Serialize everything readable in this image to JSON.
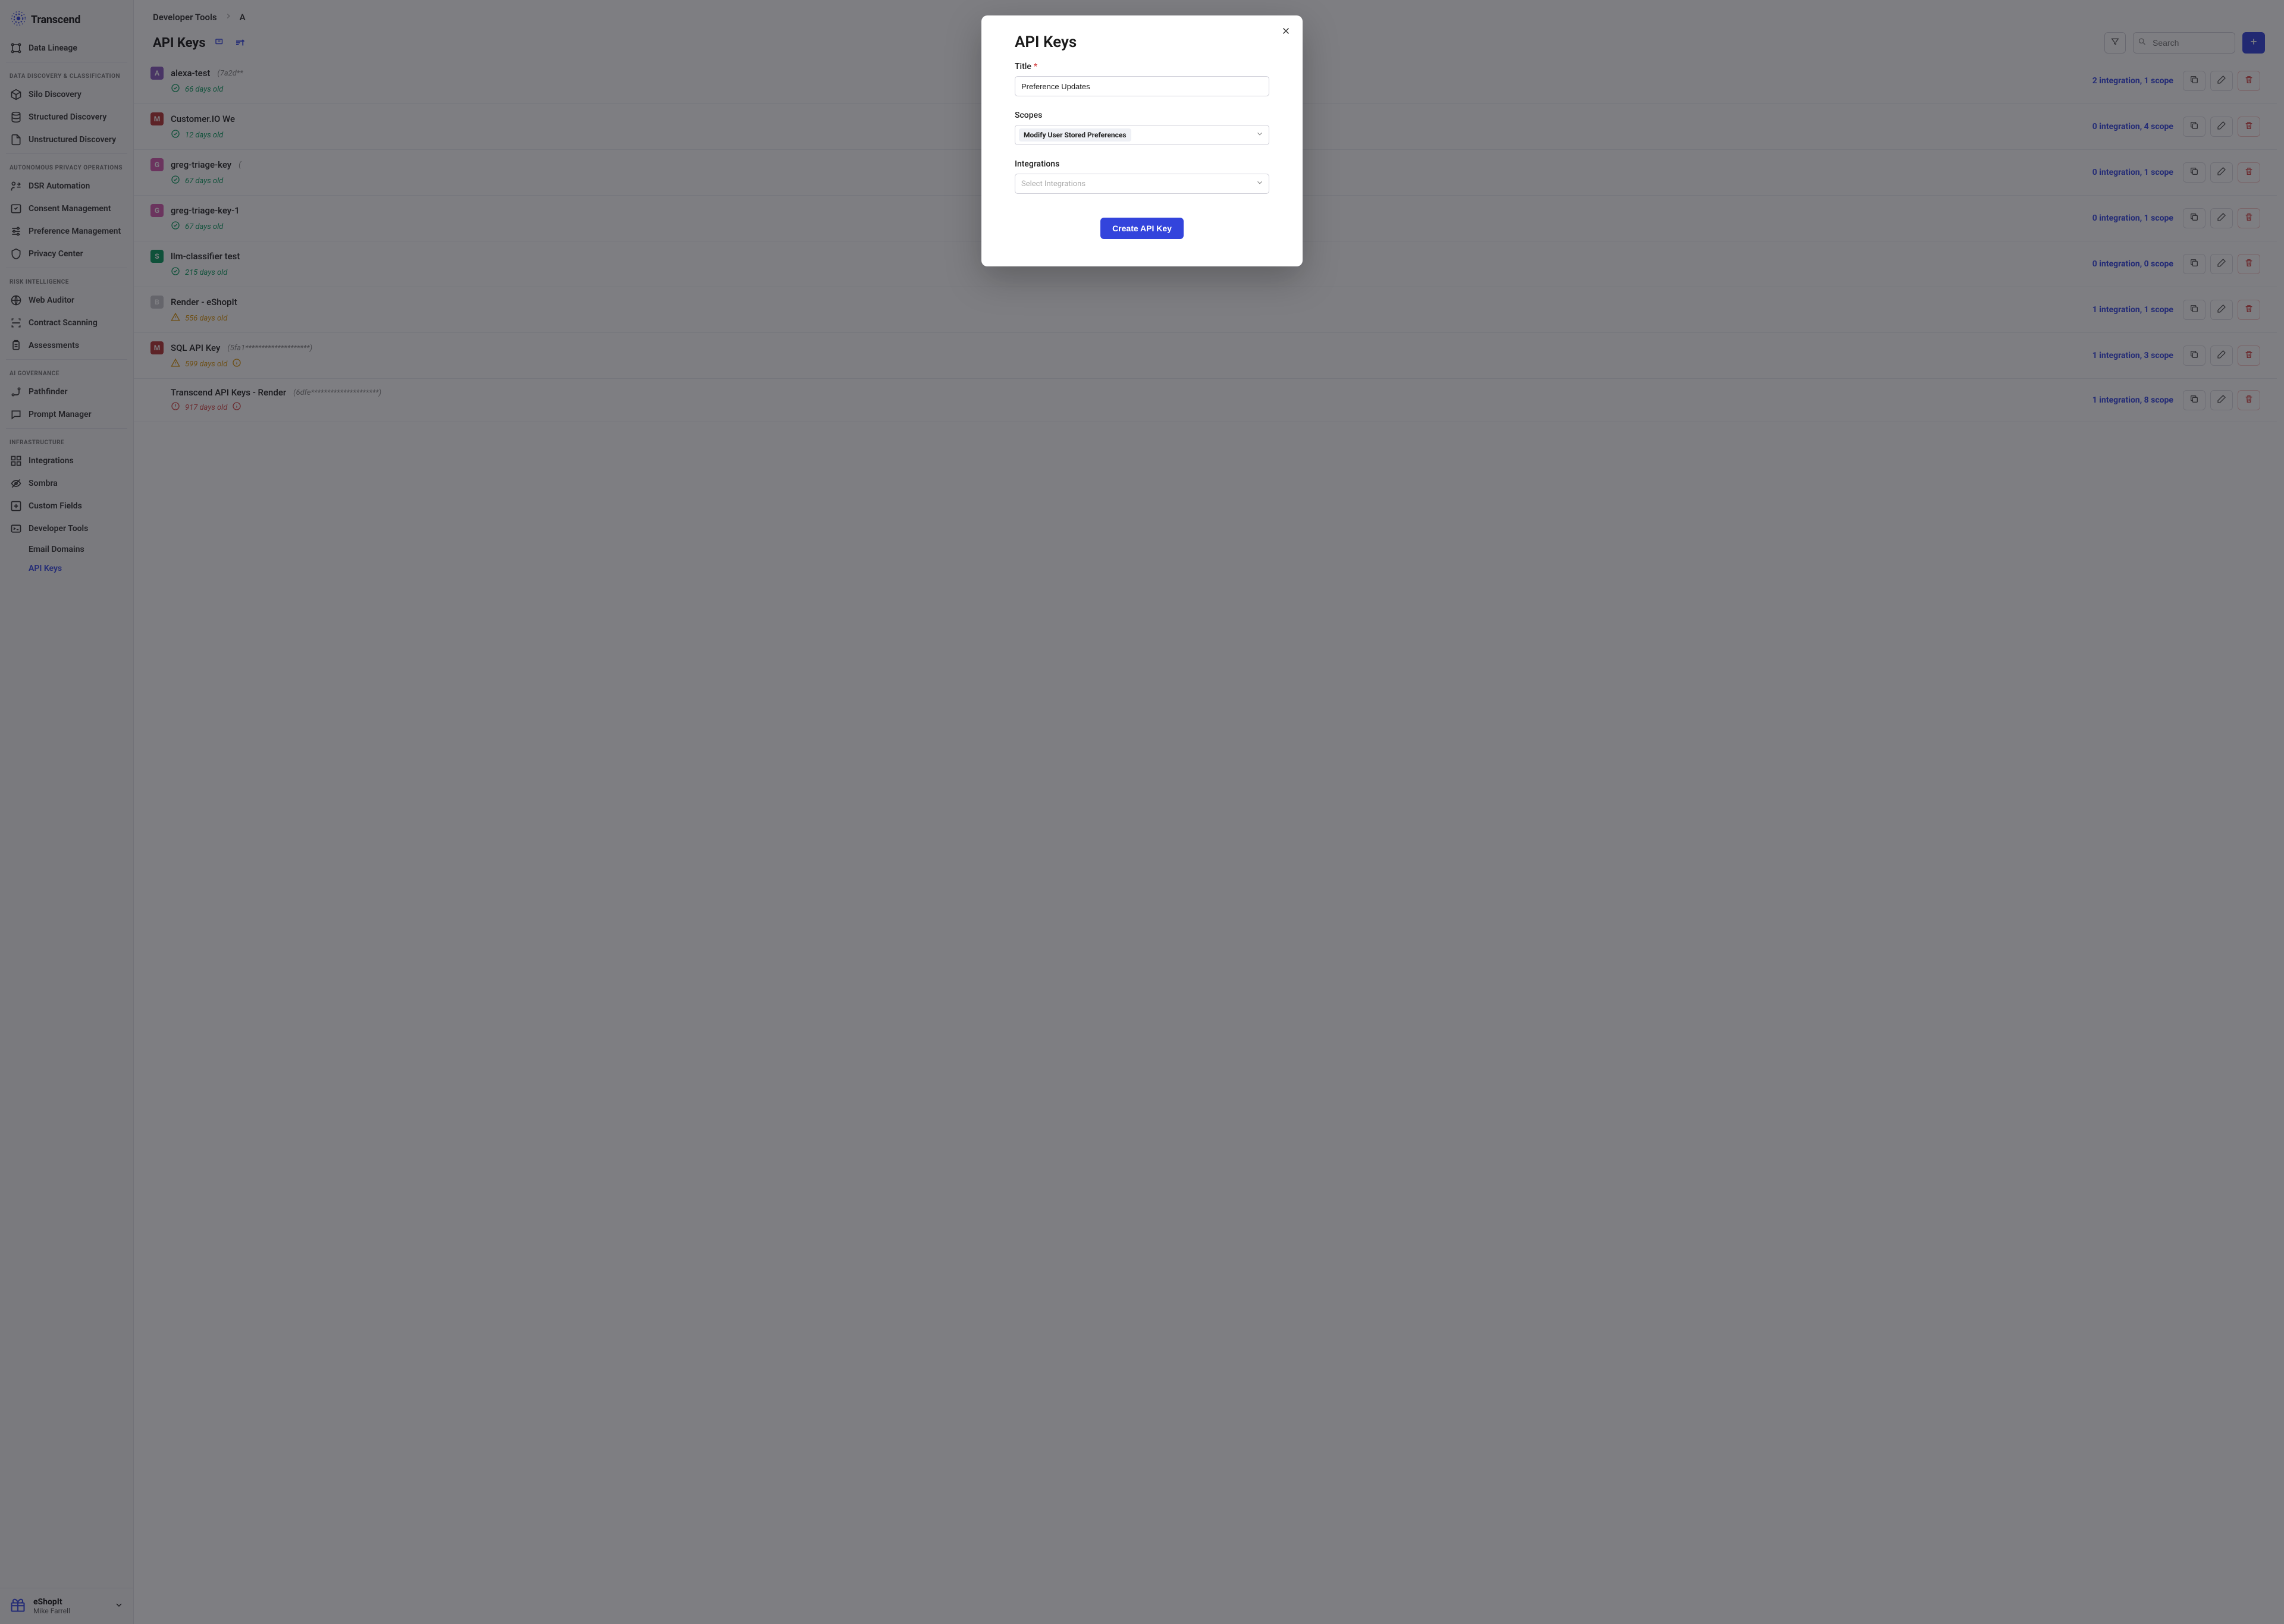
{
  "brand": {
    "name": "Transcend"
  },
  "sidebar": {
    "top_item": {
      "label": "Data Lineage"
    },
    "sections": [
      {
        "title": "DATA DISCOVERY & CLASSIFICATION",
        "items": [
          {
            "label": "Silo Discovery"
          },
          {
            "label": "Structured Discovery"
          },
          {
            "label": "Unstructured Discovery"
          }
        ]
      },
      {
        "title": "AUTONOMOUS PRIVACY OPERATIONS",
        "items": [
          {
            "label": "DSR Automation"
          },
          {
            "label": "Consent Management"
          },
          {
            "label": "Preference Management"
          },
          {
            "label": "Privacy Center"
          }
        ]
      },
      {
        "title": "RISK INTELLIGENCE",
        "items": [
          {
            "label": "Web Auditor"
          },
          {
            "label": "Contract Scanning"
          },
          {
            "label": "Assessments"
          }
        ]
      },
      {
        "title": "AI GOVERNANCE",
        "items": [
          {
            "label": "Pathfinder"
          },
          {
            "label": "Prompt Manager"
          }
        ]
      },
      {
        "title": "INFRASTRUCTURE",
        "items": [
          {
            "label": "Integrations"
          },
          {
            "label": "Sombra"
          },
          {
            "label": "Custom Fields"
          },
          {
            "label": "Developer Tools"
          }
        ],
        "subitems": [
          {
            "label": "Email Domains"
          },
          {
            "label": "API Keys",
            "active": true
          }
        ]
      }
    ],
    "footer": {
      "title": "eShopIt",
      "subtitle": "Mike Farrell"
    }
  },
  "breadcrumb": {
    "a": "Developer Tools",
    "b": "A"
  },
  "page": {
    "title": "API Keys",
    "search_placeholder": "Search"
  },
  "rows": [
    {
      "letter": "A",
      "color": "#8b5bbf",
      "name": "alexa-test",
      "hash": "(7a2d**",
      "age": "66 days old",
      "status": "ok",
      "integrations": "2 integration",
      "scopes": "1 scope"
    },
    {
      "letter": "M",
      "color": "#b73535",
      "name": "Customer.IO We",
      "hash": "",
      "age": "12 days old",
      "status": "ok",
      "integrations": "0 integration",
      "scopes": "4 scope"
    },
    {
      "letter": "G",
      "color": "#d65bb0",
      "name": "greg-triage-key",
      "hash": "(",
      "age": "67 days old",
      "status": "ok",
      "integrations": "0 integration",
      "scopes": "1 scope"
    },
    {
      "letter": "G",
      "color": "#d65bb0",
      "name": "greg-triage-key-1",
      "hash": "",
      "age": "67 days old",
      "status": "ok",
      "integrations": "0 integration",
      "scopes": "1 scope"
    },
    {
      "letter": "S",
      "color": "#0a9b5f",
      "name": "llm-classifier test",
      "hash": "",
      "age": "215 days old",
      "status": "ok",
      "integrations": "0 integration",
      "scopes": "0 scope"
    },
    {
      "letter": "B",
      "color": "#c7c7cc",
      "name": "Render - eShopIt",
      "hash": "",
      "age": "556 days old",
      "status": "warn",
      "integrations": "1 integration",
      "scopes": "1 scope"
    },
    {
      "letter": "M",
      "color": "#b73535",
      "name": "SQL API Key",
      "hash": "(5fa1********************)",
      "age": "599 days old",
      "status": "warn",
      "has_info": true,
      "integrations": "1 integration",
      "scopes": "3 scope"
    },
    {
      "letter": "",
      "color": "",
      "name": "Transcend API Keys - Render",
      "hash": "(6dfe*********************)",
      "age": "917 days old",
      "status": "err",
      "has_info": true,
      "integrations": "1 integration",
      "scopes": "8 scope"
    }
  ],
  "modal": {
    "title": "API Keys",
    "title_field_label": "Title",
    "title_field_value": "Preference Updates",
    "scopes_label": "Scopes",
    "scopes_chip": "Modify User Stored Preferences",
    "integrations_label": "Integrations",
    "integrations_placeholder": "Select Integrations",
    "submit_label": "Create API Key"
  }
}
